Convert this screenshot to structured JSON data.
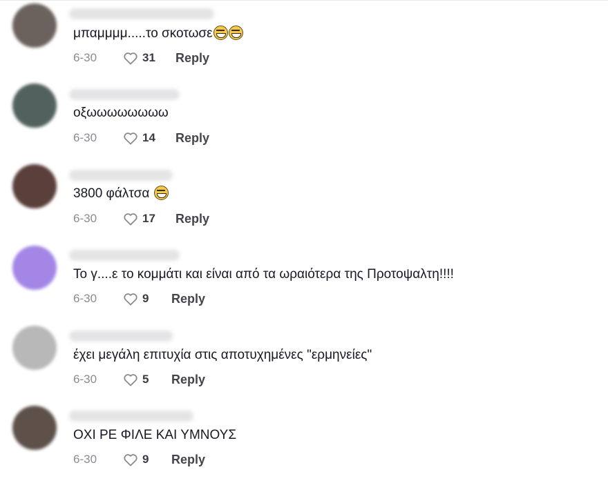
{
  "colors": {
    "text": "#161823",
    "muted": "#8a8b91",
    "reply": "#44454c"
  },
  "comments": [
    {
      "text": "μπαμμμμ.....το σκοτωσε",
      "emoji": [
        "grinning-face-with-smiling-eyes",
        "grinning-face-with-smiling-eyes"
      ],
      "date": "6-30",
      "likes": "31",
      "reply_label": "Reply",
      "avatar_color": "#6b625d"
    },
    {
      "text": "οξωωωωωωωω",
      "emoji": [],
      "date": "6-30",
      "likes": "14",
      "reply_label": "Reply",
      "avatar_color": "#51615e"
    },
    {
      "text": "3800 φάλτσα",
      "emoji": [
        "face-with-tears-of-joy"
      ],
      "date": "6-30",
      "likes": "17",
      "reply_label": "Reply",
      "avatar_color": "#5a3f3b"
    },
    {
      "text": "Το γ....ε το κομμάτι και είναι από τα ωραιότερα της Προτοψαλτη!!!!",
      "emoji": [],
      "date": "6-30",
      "likes": "9",
      "reply_label": "Reply",
      "avatar_color": "#a386e6"
    },
    {
      "text": "έχει μεγάλη επιτυχία στις αποτυχημένες \"ερμηνείες\"",
      "emoji": [],
      "date": "6-30",
      "likes": "5",
      "reply_label": "Reply",
      "avatar_color": "#b8b8b8"
    },
    {
      "text": "ΟΧΙ ΡΕ ΦΙΛΕ ΚΑΙ ΥΜΝΟΥΣ",
      "emoji": [],
      "date": "6-30",
      "likes": "9",
      "reply_label": "Reply",
      "avatar_color": "#5d514a"
    }
  ]
}
